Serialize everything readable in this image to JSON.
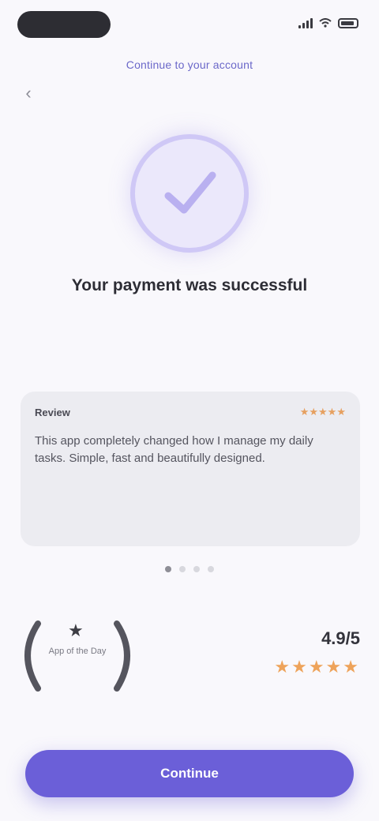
{
  "status_bar": {
    "icons": [
      "signal-icon",
      "wifi-icon",
      "battery-icon"
    ]
  },
  "header": {
    "subtitle": "Continue to your account",
    "back_icon": "chevron-left-icon"
  },
  "hero": {
    "icon": "check-circle-icon",
    "headline": "Your payment was successful"
  },
  "review_card": {
    "label": "Review",
    "badge": "★★★★★",
    "text": "This app completely changed how I manage my daily tasks. Simple, fast and beautifully designed."
  },
  "carousel": {
    "count": 4,
    "active_index": 0
  },
  "award": {
    "icon": "laurel-icon",
    "star_icon": "star-icon",
    "text": "App of the Day"
  },
  "rating": {
    "value": "4.9/5",
    "stars": "★★★★★"
  },
  "cta": {
    "label": "Continue"
  },
  "colors": {
    "accent": "#6b5fd8",
    "check_bg": "#ebe8fb",
    "star": "#eea35a"
  }
}
